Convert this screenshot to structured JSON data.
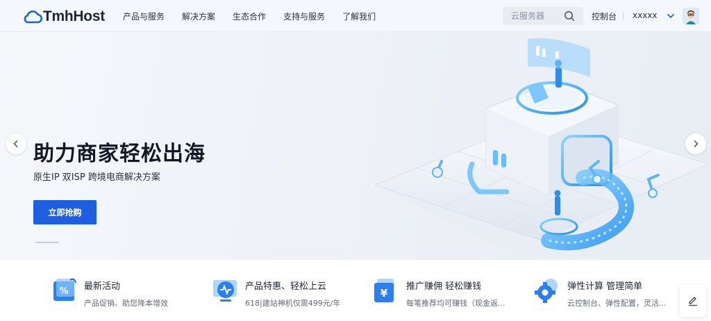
{
  "header": {
    "logo_text": "TmhHost",
    "nav": [
      "产品与服务",
      "解决方案",
      "生态合作",
      "支持与服务",
      "了解我们"
    ],
    "search_placeholder": "云服务器",
    "console_label": "控制台",
    "username": "xxxxx"
  },
  "hero": {
    "title": "助力商家轻松出海",
    "subtitle": "原生IP 双ISP 跨境电商解决方案",
    "cta_label": "立即抢购"
  },
  "features": [
    {
      "icon": "discount-icon",
      "title": "最新活动",
      "desc": "产品促销、助您降本增效"
    },
    {
      "icon": "monitor-icon",
      "title": "产品特惠、轻松上云",
      "desc": "618|建站神机仅需499元/年"
    },
    {
      "icon": "yuan-icon",
      "title": "推广赚佣 轻松赚钱",
      "desc": "每笔推荐均可赚钱（现金返..."
    },
    {
      "icon": "gear-icon",
      "title": "弹性计算 管理简单",
      "desc": "云控制台、弹性配置，灵活..."
    }
  ],
  "colors": {
    "primary": "#1d5fe0",
    "text_dark": "#121826",
    "accent_cyan": "#3aa9f0"
  }
}
